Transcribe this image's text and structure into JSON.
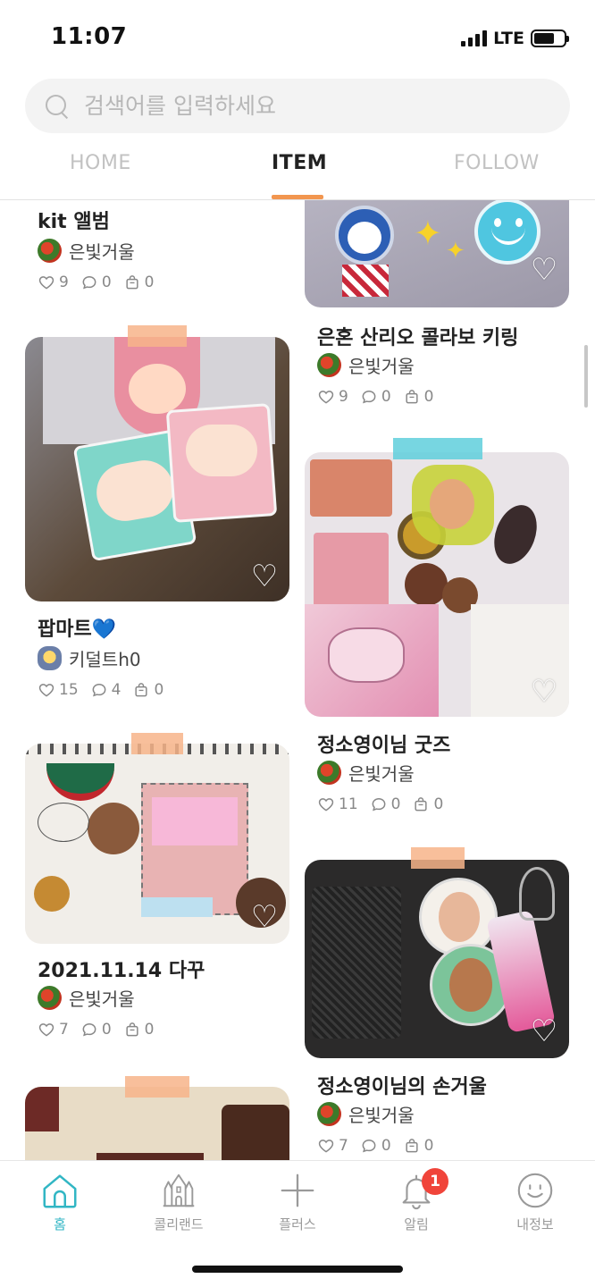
{
  "status_bar": {
    "time": "11:07",
    "network": "LTE"
  },
  "search": {
    "placeholder": "검색어를 입력하세요",
    "icon": "search-icon"
  },
  "tabs": [
    {
      "label": "HOME",
      "active": false
    },
    {
      "label": "ITEM",
      "active": true
    },
    {
      "label": "FOLLOW",
      "active": false
    }
  ],
  "feed": {
    "left": [
      {
        "title": "kit 앨범",
        "author": "은빛거울",
        "likes": "9",
        "comments": "0",
        "bags": "0"
      },
      {
        "title": "팝마트💙",
        "author": "키덜트h0",
        "likes": "15",
        "comments": "4",
        "bags": "0"
      },
      {
        "title": "2021.11.14 다꾸",
        "author": "은빛거울",
        "likes": "7",
        "comments": "0",
        "bags": "0"
      }
    ],
    "right": [
      {
        "title": "은혼 산리오 콜라보 키링",
        "author": "은빛거울",
        "likes": "9",
        "comments": "0",
        "bags": "0"
      },
      {
        "title": "정소영이님 굿즈",
        "author": "은빛거울",
        "likes": "11",
        "comments": "0",
        "bags": "0"
      },
      {
        "title": "정소영이님의 손거울",
        "author": "은빛거울",
        "likes": "7",
        "comments": "0",
        "bags": "0"
      }
    ]
  },
  "bottom_nav": [
    {
      "label": "홈",
      "icon": "home-icon",
      "active": true
    },
    {
      "label": "콜리랜드",
      "icon": "castle-icon",
      "active": false
    },
    {
      "label": "플러스",
      "icon": "plus-icon",
      "active": false
    },
    {
      "label": "알림",
      "icon": "bell-icon",
      "active": false,
      "badge": "1"
    },
    {
      "label": "내정보",
      "icon": "smile-icon",
      "active": false
    }
  ],
  "colors": {
    "accent": "#f2964f",
    "nav_active": "#31b6c4",
    "badge": "#f0443a"
  }
}
